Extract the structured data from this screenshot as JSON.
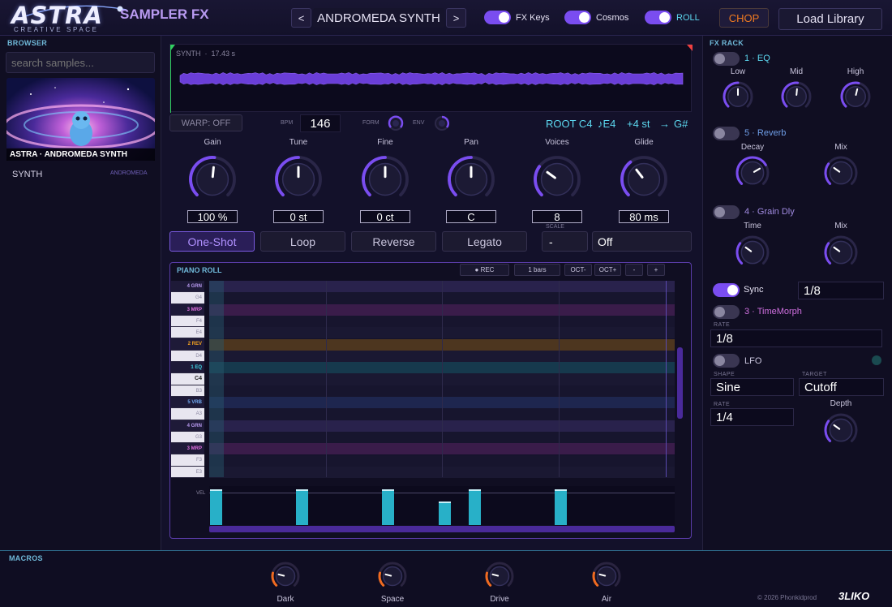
{
  "header": {
    "logo": "ASTRA",
    "logo_tagline": "CREATIVE SPACE",
    "app_subtitle": "SAMPLER FX",
    "prev_label": "<",
    "next_label": ">",
    "preset_name": "ANDROMEDA SYNTH",
    "toggles": [
      {
        "label": "FX Keys",
        "on": true
      },
      {
        "label": "Cosmos",
        "on": true
      },
      {
        "label": "ROLL",
        "on": true
      }
    ],
    "chop_label": "CHOP",
    "load_label": "Load Library"
  },
  "browser": {
    "title": "BROWSER",
    "search_placeholder": "search samples...",
    "art_caption": "ASTRA · ANDROMEDA SYNTH",
    "row_name": "SYNTH",
    "row_tag": "ANDROMEDA"
  },
  "waveform": {
    "label": "SYNTH",
    "duration": "17.43 s"
  },
  "transport": {
    "warp_label": "WARP: OFF",
    "bpm_label": "BPM",
    "bpm_value": "146",
    "form_label": "FORM",
    "env_label": "ENV",
    "root": "ROOT C4",
    "note": "♪E4",
    "semitones": "+4 st",
    "arrow": "→",
    "target_note": "G#"
  },
  "knobs": [
    {
      "label": "Gain",
      "value": "100 %",
      "level": 0.52
    },
    {
      "label": "Tune",
      "value": "0 st",
      "level": 0.5
    },
    {
      "label": "Fine",
      "value": "0 ct",
      "level": 0.5
    },
    {
      "label": "Pan",
      "value": "C",
      "level": 0.5
    },
    {
      "label": "Voices",
      "value": "8",
      "level": 0.3
    },
    {
      "label": "Glide",
      "value": "80 ms",
      "level": 0.36
    }
  ],
  "modes": {
    "buttons": [
      "One-Shot",
      "Loop",
      "Reverse",
      "Legato"
    ],
    "active": "One-Shot",
    "scale_label": "SCALE",
    "scale_value": "-",
    "scale_mode": "Off"
  },
  "piano_roll": {
    "title": "PIANO ROLL",
    "rec_label": "● REC",
    "bars_label": "1 bars",
    "oct_down": "OCT-",
    "oct_up": "OCT+",
    "zoom_out": "-",
    "zoom_in": "+",
    "vel_label": "VEL",
    "keys": [
      {
        "text": "4 GRN",
        "type": "lbl",
        "color": "#b89af0"
      },
      {
        "text": "G4",
        "type": "white"
      },
      {
        "text": "3 MRP",
        "type": "lbl",
        "color": "#e070e0"
      },
      {
        "text": "F4",
        "type": "white"
      },
      {
        "text": "E4",
        "type": "white"
      },
      {
        "text": "2 REV",
        "type": "lbl",
        "color": "#f0a020"
      },
      {
        "text": "D4",
        "type": "white"
      },
      {
        "text": "1 EQ",
        "type": "lbl",
        "color": "#40d8e8"
      },
      {
        "text": "C4",
        "type": "white"
      },
      {
        "text": "B3",
        "type": "white"
      },
      {
        "text": "5 VRB",
        "type": "lbl",
        "color": "#70a8f0"
      },
      {
        "text": "A3",
        "type": "white"
      },
      {
        "text": "4 GRN",
        "type": "lbl",
        "color": "#b89af0"
      },
      {
        "text": "G3",
        "type": "white"
      },
      {
        "text": "3 MRP",
        "type": "lbl",
        "color": "#e070e0"
      },
      {
        "text": "F3",
        "type": "white"
      },
      {
        "text": "E3",
        "type": "white"
      }
    ],
    "velocities": [
      {
        "pos": 0.0,
        "value": 1.0
      },
      {
        "pos": 0.185,
        "value": 1.0
      },
      {
        "pos": 0.37,
        "value": 1.0
      },
      {
        "pos": 0.492,
        "value": 0.66
      },
      {
        "pos": 0.555,
        "value": 1.0
      },
      {
        "pos": 0.74,
        "value": 1.0
      }
    ]
  },
  "fx_rack": {
    "title": "FX RACK",
    "eq": {
      "name": "1 · EQ",
      "color": "#5cd8f0",
      "on": false,
      "knobs": [
        {
          "label": "Low",
          "level": 0.5
        },
        {
          "label": "Mid",
          "level": 0.52
        },
        {
          "label": "High",
          "level": 0.55
        }
      ]
    },
    "reverb": {
      "name": "5 · Reverb",
      "color": "#6f9ee8",
      "on": false,
      "knobs": [
        {
          "label": "Decay",
          "level": 0.72
        },
        {
          "label": "Mix",
          "level": 0.3
        }
      ]
    },
    "grain": {
      "name": "4 · Grain Dly",
      "color": "#a08ae0",
      "on": false,
      "knobs": [
        {
          "label": "Time",
          "level": 0.3
        },
        {
          "label": "Mix",
          "level": 0.3
        }
      ]
    },
    "sync": {
      "label": "Sync",
      "on": true,
      "value": "1/8"
    },
    "timemorph": {
      "name": "3 · TimeMorph",
      "color": "#d070e0",
      "on": false,
      "rate_label": "RATE",
      "rate_value": "1/8"
    },
    "lfo": {
      "name": "LFO",
      "on": false,
      "shape_label": "SHAPE",
      "shape_value": "Sine",
      "target_label": "TARGET",
      "target_value": "Cutoff",
      "rate_label": "RATE",
      "rate_value": "1/4",
      "depth_label": "Depth",
      "depth_level": 0.3
    }
  },
  "macros": {
    "title": "MACROS",
    "items": [
      {
        "label": "Dark",
        "level": 0.22
      },
      {
        "label": "Space",
        "level": 0.22
      },
      {
        "label": "Drive",
        "level": 0.22
      },
      {
        "label": "Air",
        "level": 0.22
      }
    ],
    "copyright": "© 2026 Phonkidprod",
    "maker_logo": "3LIKO"
  },
  "colors": {
    "accent": "#7a4df0",
    "cyan": "#5cd8f0",
    "macro_orange": "#f06a20"
  }
}
